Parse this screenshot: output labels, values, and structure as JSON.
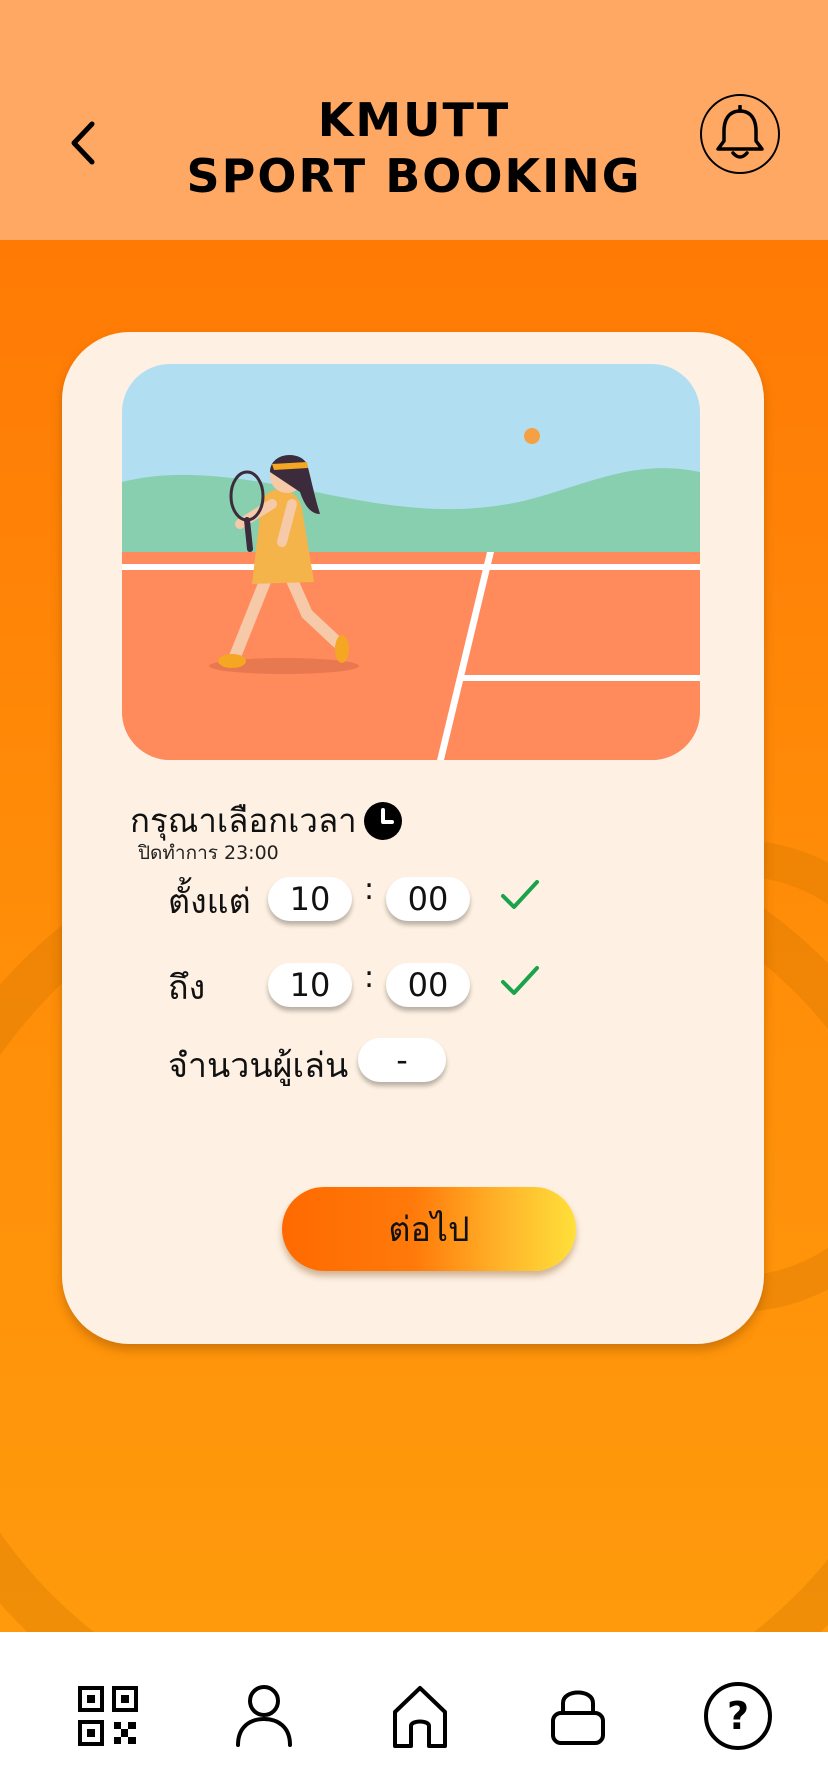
{
  "header": {
    "title_line1": "KMUTT",
    "title_line2": "SPORT BOOKING",
    "back_icon": "chevron-left-icon",
    "notification_icon": "bell-icon"
  },
  "booking": {
    "prompt": "กรุณาเลือกเวลา",
    "closing_time": "ปิดทำการ 23:00",
    "from_label": "ตั้งแต่",
    "from_hour": "10",
    "from_minute": "00",
    "to_label": "ถึง",
    "to_hour": "10",
    "to_minute": "00",
    "separator": ":",
    "players_label": "จำนวนผู้เล่น",
    "players_value": "-",
    "next_label": "ต่อไป"
  },
  "nav": {
    "items": [
      {
        "icon": "qr-code-icon"
      },
      {
        "icon": "user-icon"
      },
      {
        "icon": "home-icon"
      },
      {
        "icon": "lock-icon"
      },
      {
        "icon": "help-icon"
      }
    ]
  },
  "colors": {
    "header_bg": "#ffa864",
    "main_bg": "#ff8a0a",
    "card_bg": "#fef1e3",
    "check": "#1aa34a"
  }
}
